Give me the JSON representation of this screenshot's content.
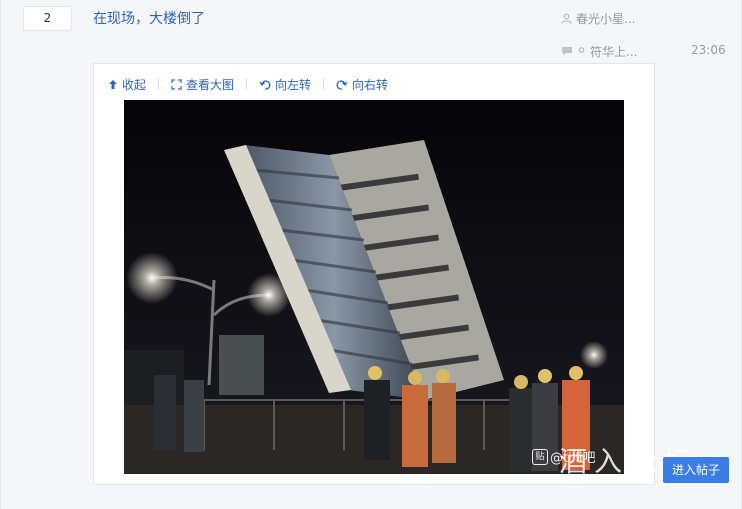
{
  "thread": {
    "reply_count": "2",
    "title": "在现场，大楼倒了",
    "author": "春光小星...",
    "last_reply_user": "符华上...",
    "last_reply_time": "23:06"
  },
  "media_toolbar": {
    "collapse": "收起",
    "view_large": "查看大图",
    "rotate_left": "向左转",
    "rotate_right": "向右转"
  },
  "photo": {
    "subject": "collapsed leaning building at night with rescue workers",
    "watermark_text": "@tilli吧",
    "watermark_badge": "贴"
  },
  "overlay": {
    "forum_mark": "酒入论坛",
    "enter_button": "进入帖子"
  },
  "icons": {
    "author": "user-icon",
    "last_reply": "comment-icon",
    "collapse": "arrow-up-icon",
    "view_large": "expand-icon",
    "rotate_left": "rotate-left-icon",
    "rotate_right": "rotate-right-icon"
  },
  "colors": {
    "link": "#2d64b3",
    "meta": "#999999",
    "page_bg": "#f4f6f9",
    "button": "#3b7de4"
  }
}
